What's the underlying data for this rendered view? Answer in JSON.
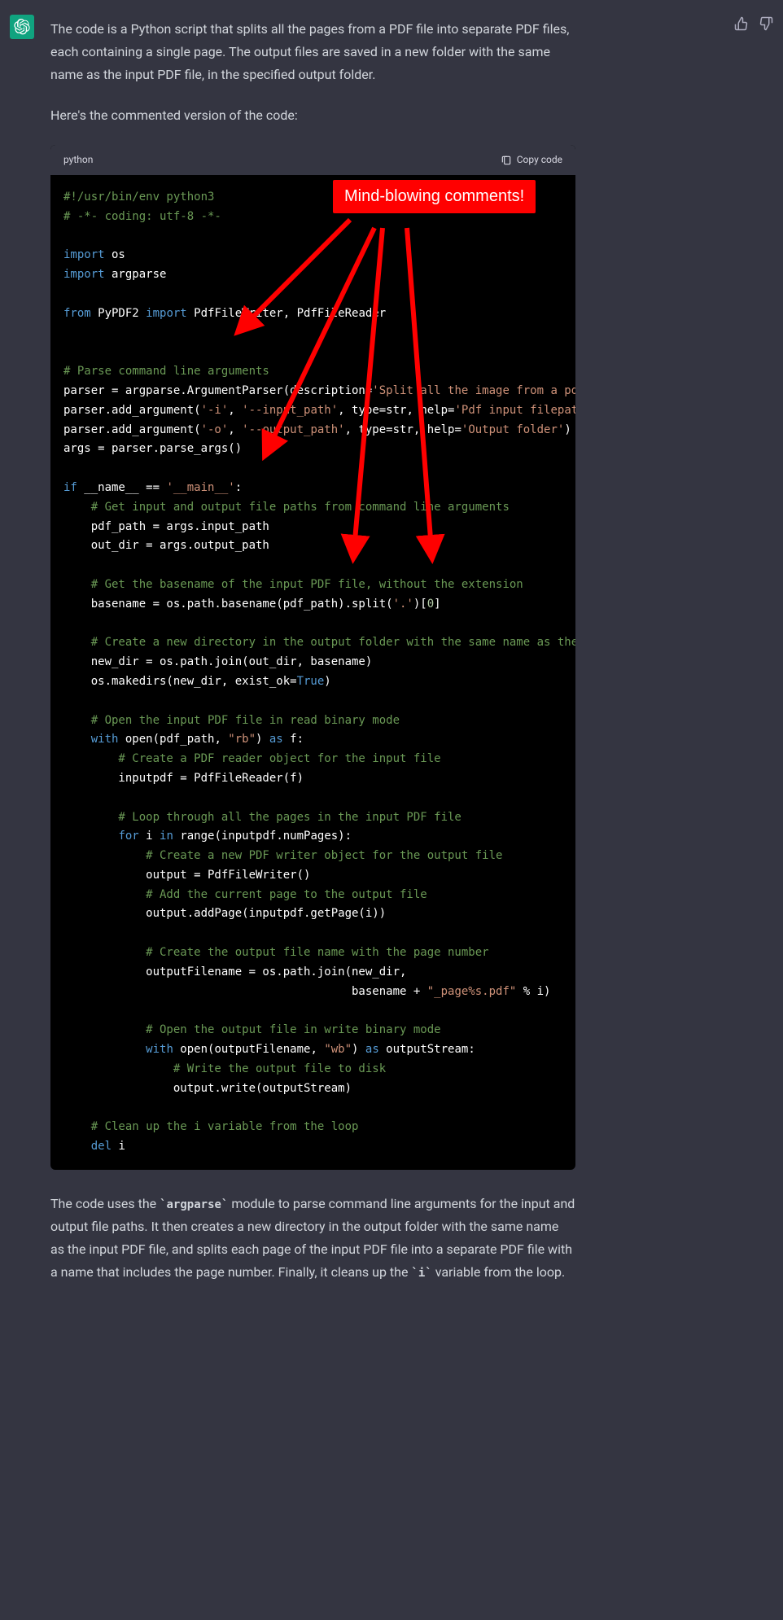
{
  "message": {
    "intro_p1": "The code is a Python script that splits all the pages from a PDF file into separate PDF files, each containing a single page. The output files are saved in a new folder with the same name as the input PDF file, in the specified output folder.",
    "intro_p2": "Here's the commented version of the code:",
    "outro_pre": "The code uses the ",
    "outro_code1": "`argparse`",
    "outro_mid": " module to parse command line arguments for the input and output file paths. It then creates a new directory in the output folder with the same name as the input PDF file, and splits each page of the input PDF file into a separate PDF file with a name that includes the page number. Finally, it cleans up the ",
    "outro_code2": "`i`",
    "outro_post": " variable from the loop."
  },
  "codeblock": {
    "lang": "python",
    "copy_label": "Copy code"
  },
  "code": {
    "l1": "#!/usr/bin/env python3",
    "l2": "# -*- coding: utf-8 -*-",
    "l3a": "import",
    "l3b": " os",
    "l4a": "import",
    "l4b": " argparse",
    "l5a": "from",
    "l5b": " PyPDF2 ",
    "l5c": "import",
    "l5d": " PdfFileWriter, PdfFileReader",
    "l6": "# Parse command line arguments",
    "l7a": "parser = argparse.ArgumentParser(description=",
    "l7b": "'Split all the image from a pdf'",
    "l7c": ")",
    "l8a": "parser.add_argument(",
    "l8b": "'-i'",
    "l8c": ", ",
    "l8d": "'--input_path'",
    "l8e": ", type=str, help=",
    "l8f": "'Pdf input filepath'",
    "l8g": ")",
    "l9a": "parser.add_argument(",
    "l9b": "'-o'",
    "l9c": ", ",
    "l9d": "'--output_path'",
    "l9e": ", type=str, help=",
    "l9f": "'Output folder'",
    "l9g": ")",
    "l10": "args = parser.parse_args()",
    "l11a": "if",
    "l11b": " __name__ == ",
    "l11c": "'__main__'",
    "l11d": ":",
    "l12": "    # Get input and output file paths from command line arguments",
    "l13": "    pdf_path = args.input_path",
    "l14": "    out_dir = args.output_path",
    "l15": "    # Get the basename of the input PDF file, without the extension",
    "l16a": "    basename = os.path.basename(pdf_path).split(",
    "l16b": "'.'",
    "l16c": ")[",
    "l16d": "0",
    "l16e": "]",
    "l17": "    # Create a new directory in the output folder with the same name as the input P",
    "l18": "    new_dir = os.path.join(out_dir, basename)",
    "l19a": "    os.makedirs(new_dir, exist_ok=",
    "l19b": "True",
    "l19c": ")",
    "l20": "    # Open the input PDF file in read binary mode",
    "l21a": "    ",
    "l21b": "with",
    "l21c": " open(pdf_path, ",
    "l21d": "\"rb\"",
    "l21e": ") ",
    "l21f": "as",
    "l21g": " f:",
    "l22": "        # Create a PDF reader object for the input file",
    "l23": "        inputpdf = PdfFileReader(f)",
    "l24": "        # Loop through all the pages in the input PDF file",
    "l25a": "        ",
    "l25b": "for",
    "l25c": " i ",
    "l25d": "in",
    "l25e": " range(inputpdf.numPages):",
    "l26": "            # Create a new PDF writer object for the output file",
    "l27": "            output = PdfFileWriter()",
    "l28": "            # Add the current page to the output file",
    "l29": "            output.addPage(inputpdf.getPage(i))",
    "l30": "            # Create the output file name with the page number",
    "l31": "            outputFilename = os.path.join(new_dir,",
    "l32a": "                                          basename + ",
    "l32b": "\"_page%s.pdf\"",
    "l32c": " % i)",
    "l33": "            # Open the output file in write binary mode",
    "l34a": "            ",
    "l34b": "with",
    "l34c": " open(outputFilename, ",
    "l34d": "\"wb\"",
    "l34e": ") ",
    "l34f": "as",
    "l34g": " outputStream:",
    "l35": "                # Write the output file to disk",
    "l36": "                output.write(outputStream)",
    "l37": "    # Clean up the i variable from the loop",
    "l38a": "    ",
    "l38b": "del",
    "l38c": " i"
  },
  "annotation": {
    "text": "Mind-blowing comments!"
  }
}
